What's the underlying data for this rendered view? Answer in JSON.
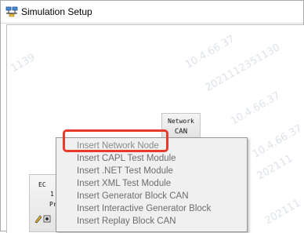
{
  "window": {
    "title": "Simulation Setup"
  },
  "network_node": {
    "line1": "Network",
    "line2": "CAN"
  },
  "ecu_node": {
    "line1": "EC",
    "line2": "1",
    "line3": "Pr"
  },
  "context_menu": {
    "items": [
      "Insert Network Node",
      "Insert CAPL Test Module",
      "Insert .NET Test Module",
      "Insert XML Test Module",
      "Insert Generator Block CAN",
      "Insert Interactive Generator Block",
      "Insert Replay Block CAN"
    ]
  },
  "watermarks": [
    "10.4.66.37",
    "2021112351130",
    "10.4.66.37",
    "202111",
    "10.4.66.37",
    "202111",
    "1139"
  ],
  "colors": {
    "highlight": "#e8392b",
    "menu_bg": "#f0f0f0",
    "menu_text": "#6d6d6d"
  }
}
